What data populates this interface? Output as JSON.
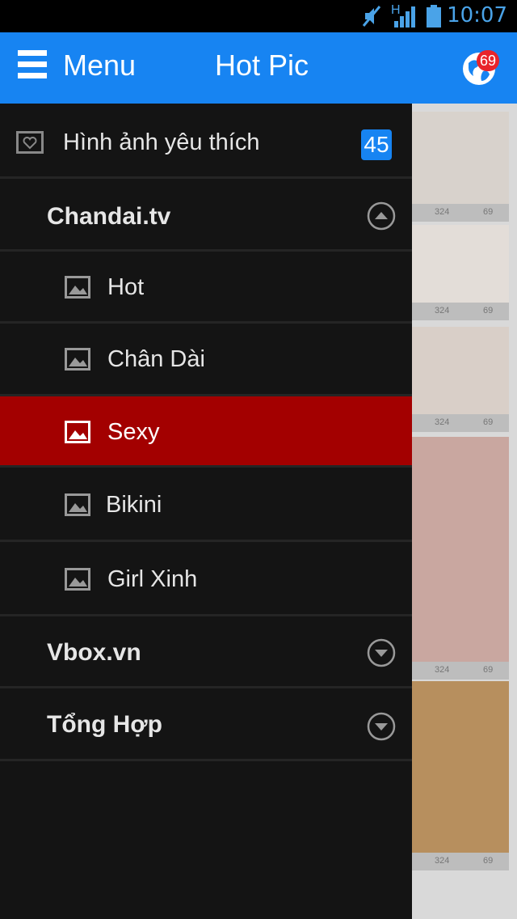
{
  "status_bar": {
    "time": "10:07",
    "network_label": "H",
    "icons": [
      "mute-icon",
      "signal-icon",
      "battery-icon"
    ]
  },
  "app_bar": {
    "menu_label": "Menu",
    "title": "Hot Pic",
    "notification_count": "69"
  },
  "drawer": {
    "favorites": {
      "label": "Hình ảnh yêu thích",
      "count": "45",
      "icon": "heart-frame-icon"
    },
    "sections": [
      {
        "label": "Chandai.tv",
        "expanded": true,
        "items": [
          {
            "label": "Hot",
            "selected": false
          },
          {
            "label": "Chân Dài",
            "selected": false
          },
          {
            "label": "Sexy",
            "selected": true
          },
          {
            "label": "Bikini",
            "selected": false
          },
          {
            "label": "Girl Xinh",
            "selected": false
          }
        ]
      },
      {
        "label": "Vbox.vn",
        "expanded": false
      },
      {
        "label": "Tổng Hợp",
        "expanded": false
      }
    ]
  },
  "background_list": {
    "meta_values": [
      "324",
      "69"
    ]
  },
  "colors": {
    "app_bar": "#1784f2",
    "selected_row": "#a30000",
    "drawer_bg": "#141414",
    "badge": "#e8242b"
  }
}
